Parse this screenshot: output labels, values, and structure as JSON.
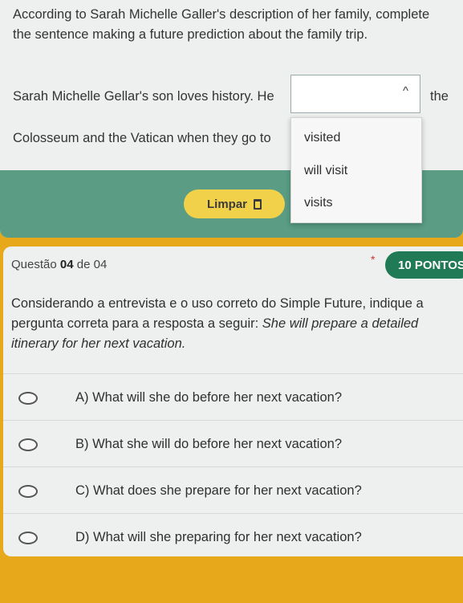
{
  "q3": {
    "prompt": "According to Sarah Michelle Galler's description of her family, complete the sentence making a future prediction about the family trip.",
    "sentence_part1": "Sarah Michelle Gellar's son loves history. He",
    "sentence_part2": "the",
    "sentence_part3": "Colosseum and the Vatican when they go to",
    "dropdown_caret": "^",
    "options": [
      "visited",
      "will visit",
      "visits"
    ],
    "clear_label": "Limpar"
  },
  "q4": {
    "question_prefix": "Questão",
    "question_number": "04",
    "question_of": "de 04",
    "required_mark": "*",
    "points": "10 PONTOS",
    "text": "Considerando a entrevista e o uso correto do Simple Future, indique a pergunta correta para a resposta a seguir:",
    "quote": "She will prepare a detailed itinerary for her next vacation.",
    "answers": [
      "A) What will she do before her next vacation?",
      "B) What she will do before her next vacation?",
      "C) What does she prepare for her next vacation?",
      "D) What will she preparing for her next vacation?"
    ]
  },
  "colors": {
    "background": "#e8a81c",
    "footer": "#5a9c84",
    "clear_button": "#f1d14a",
    "points_badge": "#1f7a55"
  }
}
